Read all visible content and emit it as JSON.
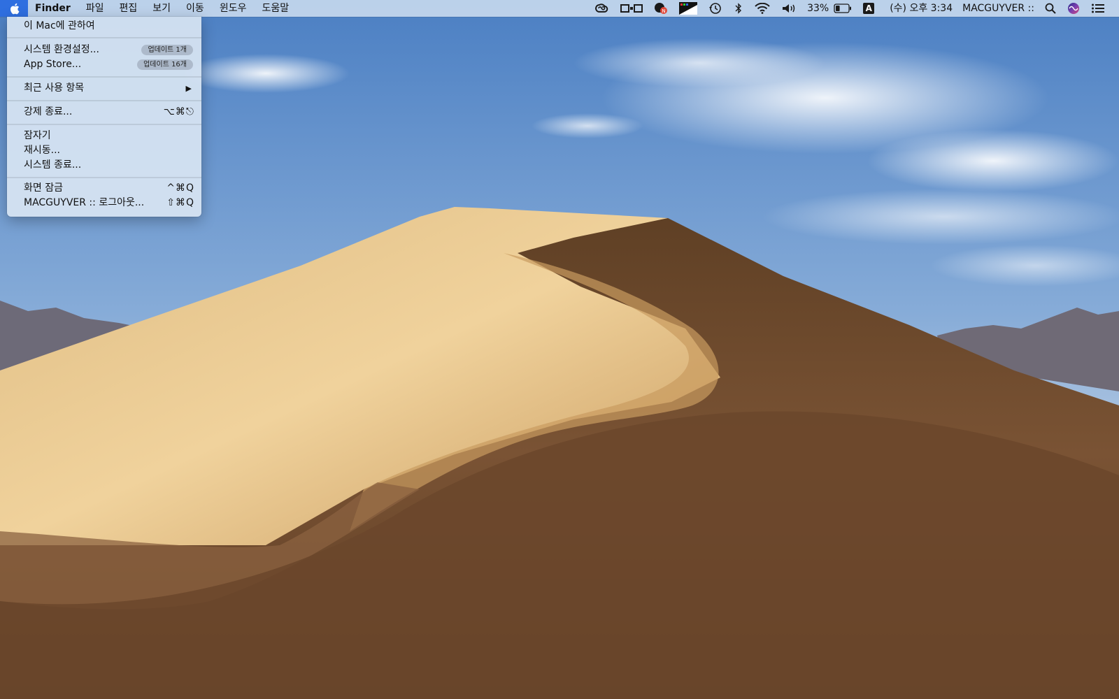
{
  "menubar": {
    "apple_icon": "apple-logo-icon",
    "app_name": "Finder",
    "menus": [
      "파일",
      "편집",
      "보기",
      "이동",
      "윈도우",
      "도움말"
    ],
    "status_icons": [
      "creative-cloud-icon",
      "display-mirror-icon",
      "chat-notification-icon",
      "screen-capture-icon",
      "time-machine-icon",
      "bluetooth-icon",
      "wifi-icon",
      "volume-icon"
    ],
    "battery_percent": "33%",
    "battery_level": 0.33,
    "input_source": "A",
    "clock": "(수) 오후 3:34",
    "user_name": "MACGUYVER ::",
    "spotlight_icon": "spotlight-search-icon",
    "siri_icon": "siri-icon",
    "notification_center_icon": "notification-center-icon"
  },
  "apple_menu": {
    "items": [
      {
        "label": "이 Mac에 관하여"
      },
      {
        "label": "시스템 환경설정...",
        "badge": "업데이트 1개"
      },
      {
        "label": "App Store...",
        "badge": "업데이트 16개"
      },
      {
        "label": "최근 사용 항목"
      },
      {
        "label": "강제 종료...",
        "shortcut": "⌥⌘⎋"
      },
      {
        "label": "잠자기"
      },
      {
        "label": "재시동..."
      },
      {
        "label": "시스템 종료..."
      },
      {
        "label": "화면 잠금",
        "shortcut": "^⌘Q"
      },
      {
        "label": "MACGUYVER :: 로그아웃...",
        "shortcut": "⇧⌘Q"
      }
    ]
  },
  "colors": {
    "menu_highlight": "#2f6fe0",
    "menubar_bg": "#cedef0",
    "menu_bg": "#d7e4f2",
    "sky_top": "#4a7fc4",
    "sand_light": "#e6c58a",
    "sand_dark": "#6e4a2c"
  }
}
